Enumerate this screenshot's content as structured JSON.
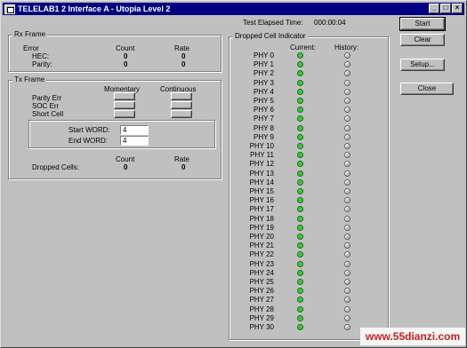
{
  "window": {
    "title": "TELELAB1 2 Interface A - Utopia Level 2"
  },
  "titlebar_buttons": {
    "minimize": "_",
    "maximize": "□",
    "close": "×"
  },
  "elapsed": {
    "label": "Test Elapsed Time:",
    "value": "000:00:04"
  },
  "buttons": {
    "start": "Start",
    "clear": "Clear",
    "setup": "Setup...",
    "close": "Close"
  },
  "rx_frame": {
    "title": "Rx Frame",
    "error_header": "Error",
    "count_header": "Count",
    "rate_header": "Rate",
    "rows": [
      {
        "label": "HEC:",
        "count": "0",
        "rate": "0"
      },
      {
        "label": "Parity:",
        "count": "0",
        "rate": "0"
      }
    ]
  },
  "tx_frame": {
    "title": "Tx Frame",
    "momentary_header": "Momentary",
    "continuous_header": "Continuous",
    "rows": [
      "Parity Err",
      "SOC Err",
      "Short Cell"
    ],
    "start_word_label": "Start WORD:",
    "start_word_value": "4",
    "end_word_label": "End WORD:",
    "end_word_value": "4",
    "count_header": "Count",
    "rate_header": "Rate",
    "dropped_label": "Dropped Cells:",
    "dropped_count": "0",
    "dropped_rate": "0"
  },
  "dropped_indicator": {
    "title": "Dropped Cell Indicator",
    "current_header": "Current:",
    "history_header": "History:",
    "phys": [
      "PHY 0",
      "PHY 1",
      "PHY 2",
      "PHY 3",
      "PHY 4",
      "PHY 5",
      "PHY 6",
      "PHY 7",
      "PHY 8",
      "PHY 9",
      "PHY 10",
      "PHY 11",
      "PHY 12",
      "PHY 13",
      "PHY 14",
      "PHY 15",
      "PHY 16",
      "PHY 17",
      "PHY 18",
      "PHY 19",
      "PHY 20",
      "PHY 21",
      "PHY 22",
      "PHY 23",
      "PHY 24",
      "PHY 25",
      "PHY 26",
      "PHY 27",
      "PHY 28",
      "PHY 29",
      "PHY 30"
    ]
  },
  "colors": {
    "current_led": "#3ec83e",
    "title_bar": "#000080"
  },
  "watermark": "www.55dianzi.com"
}
